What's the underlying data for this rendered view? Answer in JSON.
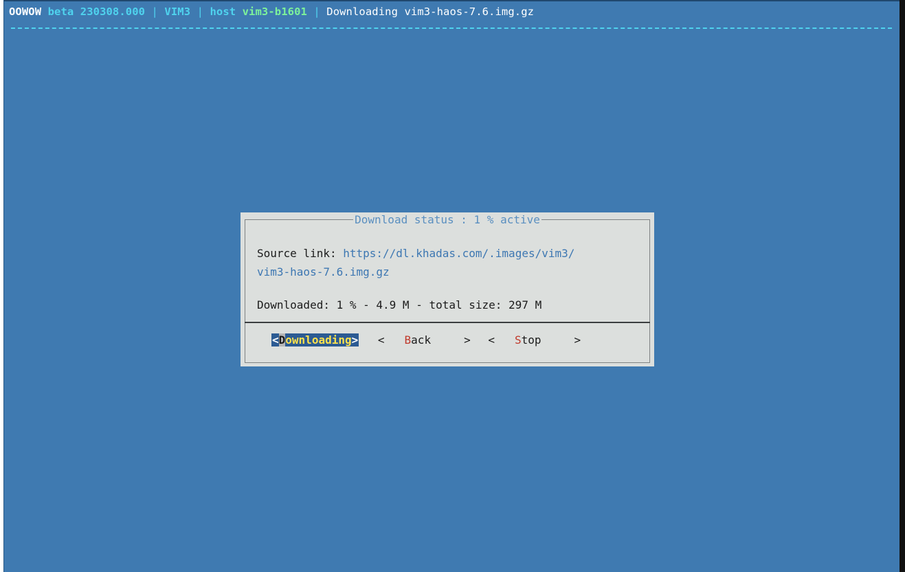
{
  "topbar": {
    "brand": "OOWOW",
    "version": "beta 230308.000",
    "separator": "|",
    "board": "VIM3",
    "host_label": "host",
    "hostname": "vim3-b1601",
    "status": "Downloading vim3-haos-7.6.img.gz"
  },
  "dialog": {
    "title": "Download status : 1 % active",
    "source_label": "Source link:",
    "source_url_part1": "https://dl.khadas.com/.images/vim3/",
    "source_url_part2": "vim3-haos-7.6.img.gz",
    "downloaded_text": "Downloaded: 1 % - 4.9 M - total size: 297 M",
    "progress_percent": 1,
    "buttons": {
      "downloading": {
        "open": "<",
        "hot": "D",
        "rest": "ownloading",
        "close": ">"
      },
      "back": {
        "open": "<",
        "hot": "B",
        "rest": "ack",
        "close": ">"
      },
      "stop": {
        "open": "<",
        "hot": "S",
        "rest": "top",
        "close": ">"
      }
    }
  },
  "colors": {
    "background": "#3f7ab1",
    "dialog": "#dcdfdd",
    "accent_cyan": "#4fd3ee",
    "accent_green": "#7df29a",
    "link": "#3d77b2",
    "hotkey": "#c0392b",
    "active_button_bg": "#2c5b93",
    "active_button_text": "#ffe24d"
  }
}
